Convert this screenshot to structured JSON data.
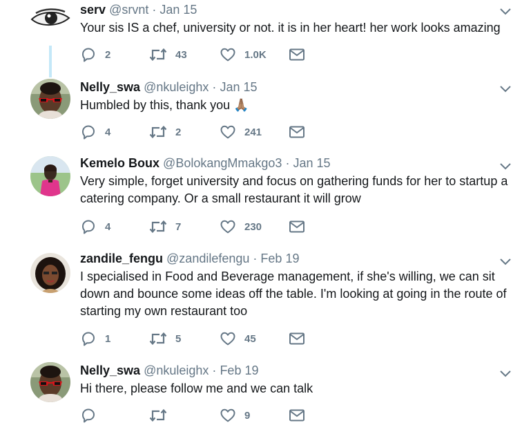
{
  "tweets": [
    {
      "name": "serv",
      "handle": "@srvnt",
      "sep": "·",
      "date": "Jan 15",
      "text": "Your sis IS a chef, university or not. it is in her heart! her work looks amazing",
      "reply": "2",
      "retweet": "43",
      "like": "1.0K"
    },
    {
      "name": "Nelly_swa",
      "handle": "@nkuleighx",
      "sep": "·",
      "date": "Jan 15",
      "text": "Humbled by this, thank you 🙏🏽",
      "reply": "4",
      "retweet": "2",
      "like": "241"
    },
    {
      "name": "Kemelo Boux",
      "handle": "@BolokangMmakgo3",
      "sep": "·",
      "date": "Jan 15",
      "text": "Very simple, forget university and focus on gathering funds for her to startup a catering company. Or a small restaurant it will grow",
      "reply": "4",
      "retweet": "7",
      "like": "230"
    },
    {
      "name": "zandile_fengu",
      "handle": "@zandilefengu",
      "sep": "·",
      "date": "Feb 19",
      "text": "I specialised in Food and Beverage management, if she's willing, we can sit down and bounce some ideas off the table. I'm looking at going in the route of starting my own restaurant too",
      "reply": "1",
      "retweet": "5",
      "like": "45"
    },
    {
      "name": "Nelly_swa",
      "handle": "@nkuleighx",
      "sep": "·",
      "date": "Feb 19",
      "text": "Hi there, please follow me and we can talk",
      "reply": "",
      "retweet": "",
      "like": "9"
    }
  ],
  "colors": {
    "thread_line": "#c4e8f8",
    "secondary_text": "#657786",
    "primary_text": "#14171a"
  },
  "icons": [
    "reply-icon",
    "retweet-icon",
    "like-icon",
    "dm-icon",
    "chevron-down-icon"
  ]
}
